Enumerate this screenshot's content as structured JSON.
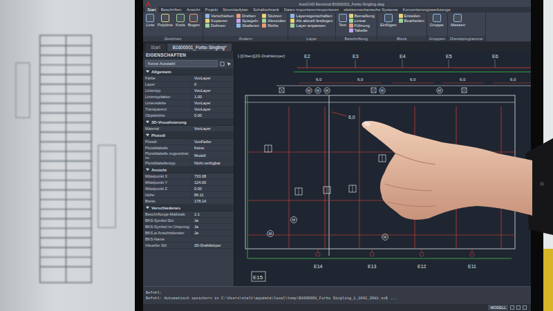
{
  "window": {
    "title": "AutoCAD Electrical  B1600001_Forbo Singling.dwg"
  },
  "ribbon_tabs": [
    {
      "label": "Start",
      "selected": true
    },
    {
      "label": "Beschriften",
      "selected": false
    },
    {
      "label": "Ansicht",
      "selected": false
    },
    {
      "label": "Projekt",
      "selected": false
    },
    {
      "label": "Stromlaufplan",
      "selected": false
    },
    {
      "label": "Schaltschrank",
      "selected": false
    },
    {
      "label": "Daten importieren/exportieren",
      "selected": false
    },
    {
      "label": "elektromechanische Systeme",
      "selected": false
    },
    {
      "label": "Konvertierungswerkzeuge",
      "selected": false
    }
  ],
  "ribbon_panels": [
    {
      "label": "Zeichnen",
      "kind": "large",
      "tools": [
        "Linie",
        "Polylinie",
        "Kreis",
        "Bogen"
      ]
    },
    {
      "label": "Ändern",
      "kind": "grid",
      "tools": [
        "Verschieben",
        "Kopieren",
        "Dehnen",
        "Drehen",
        "Spiegeln",
        "Skalieren",
        "Stutzen",
        "Abrunden",
        "Reihe"
      ]
    },
    {
      "label": "Layer",
      "kind": "list",
      "tools": [
        "Layereigenschaften",
        "Als aktuell festlegen",
        "Layer anpassen"
      ]
    },
    {
      "label": "Beschriftung",
      "kind": "mixed",
      "tools": [
        "Text",
        "Bemaßung",
        "Linear",
        "Führung",
        "Tabelle"
      ]
    },
    {
      "label": "Block",
      "kind": "mixed",
      "tools": [
        "Einfügen",
        "Erstellen",
        "Bearbeiten"
      ]
    },
    {
      "label": "Gruppen",
      "kind": "large",
      "tools": [
        "Gruppe"
      ]
    },
    {
      "label": "Dienstprogramme",
      "kind": "large",
      "tools": [
        "Messen"
      ]
    }
  ],
  "document_tabs": [
    {
      "label": "Start",
      "selected": false
    },
    {
      "label": "B1600001_Forbo Singling*",
      "selected": true
    }
  ],
  "properties": {
    "title": "EIGENSCHAFTEN",
    "selection": "Keine Auswahl",
    "sections": [
      {
        "label": "Allgemein",
        "expanded": true,
        "rows": [
          {
            "label": "Farbe",
            "value": "VonLayer"
          },
          {
            "label": "Layer",
            "value": "0"
          },
          {
            "label": "Linientyp",
            "value": "VonLayer"
          },
          {
            "label": "Linientypfaktor",
            "value": "1.00"
          },
          {
            "label": "Linienstärke",
            "value": "VonLayer"
          },
          {
            "label": "Transparenz",
            "value": "VonLayer"
          },
          {
            "label": "Objekthöhe",
            "value": "0.00"
          }
        ]
      },
      {
        "label": "3D-Visualisierung",
        "expanded": true,
        "rows": [
          {
            "label": "Material",
            "value": "VonLayer"
          }
        ]
      },
      {
        "label": "Plotstil",
        "expanded": true,
        "rows": [
          {
            "label": "Plotstil",
            "value": "VonFarbe"
          },
          {
            "label": "Plotstiltabelle",
            "value": "Keine"
          },
          {
            "label": "Plotstiltabelle zugeordnet zu",
            "value": "Modell"
          },
          {
            "label": "Plotstiltabellentyp",
            "value": "Nicht verfügbar"
          }
        ]
      },
      {
        "label": "Ansicht",
        "expanded": true,
        "rows": [
          {
            "label": "Mittelpunkt X",
            "value": "733.08"
          },
          {
            "label": "Mittelpunkt Y",
            "value": "124.00"
          },
          {
            "label": "Mittelpunkt Z",
            "value": "0.00"
          },
          {
            "label": "Höhe",
            "value": "84.11"
          },
          {
            "label": "Breite",
            "value": "178.14"
          }
        ]
      },
      {
        "label": "Verschiedenes",
        "expanded": true,
        "rows": [
          {
            "label": "Beschriftungs-Maßstab",
            "value": "1:1"
          },
          {
            "label": "BKS-Symbol Ein",
            "value": "Ja"
          },
          {
            "label": "BKS-Symbol im Ursprung",
            "value": "Ja"
          },
          {
            "label": "BKS je Ansichtsfenster",
            "value": "Ja"
          },
          {
            "label": "BKS-Name",
            "value": ""
          },
          {
            "label": "Visueller Stil",
            "value": "2D-Drahtkörper"
          }
        ]
      }
    ]
  },
  "viewport": {
    "label": "[-][Oben][2D-Drahtkörper]",
    "grid_top": [
      "E2",
      "E3",
      "E4",
      "E5",
      "E6"
    ],
    "grid_bottom": [
      "E15",
      "E14",
      "E13",
      "E12",
      "E11"
    ],
    "dimensions": [
      "6,0",
      "6,0",
      "6,0",
      "6,0",
      "6,0"
    ],
    "leader_dimension": "6,0",
    "motor_label": "M"
  },
  "command_line": {
    "history": [
      "Befehl:",
      "Befehl: Automatisch speichern in C:\\Users\\stalt\\appdata\\local\\temp\\B1600001_Forbo Singling_1_1042_2081.sv$ ..."
    ]
  },
  "status_bar": {
    "mode": "MODELL"
  }
}
